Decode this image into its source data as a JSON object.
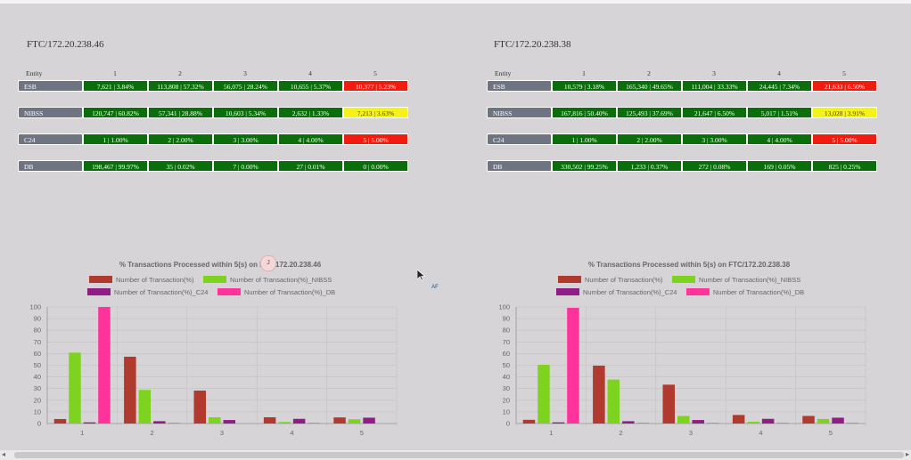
{
  "panels": [
    {
      "title": "FTC/172.20.238.46",
      "entity_header": "Entity",
      "columns": [
        "1",
        "2",
        "3",
        "4",
        "5"
      ],
      "rows": [
        {
          "entity": "ESB",
          "cells": [
            {
              "text": "7,621 | 3.84%",
              "status": "green"
            },
            {
              "text": "113,808 | 57.32%",
              "status": "green"
            },
            {
              "text": "56,075 | 28.24%",
              "status": "green"
            },
            {
              "text": "10,655 | 5.37%",
              "status": "green"
            },
            {
              "text": "10,377 | 5.23%",
              "status": "red"
            }
          ]
        },
        {
          "entity": "NIBSS",
          "cells": [
            {
              "text": "120,747 | 60.82%",
              "status": "green"
            },
            {
              "text": "57,341 | 28.88%",
              "status": "green"
            },
            {
              "text": "10,603 | 5.34%",
              "status": "green"
            },
            {
              "text": "2,632 | 1.33%",
              "status": "green"
            },
            {
              "text": "7,213 | 3.63%",
              "status": "yellow"
            }
          ]
        },
        {
          "entity": "C24",
          "cells": [
            {
              "text": "1 | 1.00%",
              "status": "green"
            },
            {
              "text": "2 | 2.00%",
              "status": "green"
            },
            {
              "text": "3 | 3.00%",
              "status": "green"
            },
            {
              "text": "4 | 4.00%",
              "status": "green"
            },
            {
              "text": "5 | 5.00%",
              "status": "red"
            }
          ]
        },
        {
          "entity": "DB",
          "cells": [
            {
              "text": "198,467 | 99.97%",
              "status": "green"
            },
            {
              "text": "35 | 0.02%",
              "status": "green"
            },
            {
              "text": "7 | 0.00%",
              "status": "green"
            },
            {
              "text": "27 | 0.01%",
              "status": "green"
            },
            {
              "text": "0 | 0.00%",
              "status": "green"
            }
          ]
        }
      ]
    },
    {
      "title": "FTC/172.20.238.38",
      "entity_header": "Entity",
      "columns": [
        "1",
        "2",
        "3",
        "4",
        "5"
      ],
      "rows": [
        {
          "entity": "ESB",
          "cells": [
            {
              "text": "10,579 | 3.18%",
              "status": "green"
            },
            {
              "text": "165,340 | 49.65%",
              "status": "green"
            },
            {
              "text": "111,004 | 33.33%",
              "status": "green"
            },
            {
              "text": "24,445 | 7.34%",
              "status": "green"
            },
            {
              "text": "21,633 | 6.50%",
              "status": "red"
            }
          ]
        },
        {
          "entity": "NIBSS",
          "cells": [
            {
              "text": "167,816 | 50.40%",
              "status": "green"
            },
            {
              "text": "125,493 | 37.69%",
              "status": "green"
            },
            {
              "text": "21,647 | 6.50%",
              "status": "green"
            },
            {
              "text": "5,017 | 1.51%",
              "status": "green"
            },
            {
              "text": "13,028 | 3.91%",
              "status": "yellow"
            }
          ]
        },
        {
          "entity": "C24",
          "cells": [
            {
              "text": "1 | 1.00%",
              "status": "green"
            },
            {
              "text": "2 | 2.00%",
              "status": "green"
            },
            {
              "text": "3 | 3.00%",
              "status": "green"
            },
            {
              "text": "4 | 4.00%",
              "status": "green"
            },
            {
              "text": "5 | 5.00%",
              "status": "red"
            }
          ]
        },
        {
          "entity": "DB",
          "cells": [
            {
              "text": "330,502 | 99.25%",
              "status": "green"
            },
            {
              "text": "1,233 | 0.37%",
              "status": "green"
            },
            {
              "text": "272 | 0.08%",
              "status": "green"
            },
            {
              "text": "169 | 0.05%",
              "status": "green"
            },
            {
              "text": "825 | 0.25%",
              "status": "green"
            }
          ]
        }
      ]
    }
  ],
  "chart_data": [
    {
      "type": "bar",
      "title": "% Transactions Processed within 5(s) on FTC/172.20.238.46",
      "categories": [
        "1",
        "2",
        "3",
        "4",
        "5"
      ],
      "ylim": [
        0,
        100
      ],
      "yticks": [
        0,
        10,
        20,
        30,
        40,
        50,
        60,
        70,
        80,
        90,
        100
      ],
      "grid": true,
      "legend_position": "top",
      "series": [
        {
          "name": "Number of Transaction(%)",
          "color": "#b03a2e",
          "values": [
            3.84,
            57.32,
            28.24,
            5.37,
            5.23
          ]
        },
        {
          "name": "Number of Transaction(%)_NIBSS",
          "color": "#7ed321",
          "values": [
            60.82,
            28.88,
            5.34,
            1.33,
            3.63
          ]
        },
        {
          "name": "Number of Transaction(%)_C24",
          "color": "#8e1e86",
          "values": [
            1,
            2,
            3,
            4,
            5
          ]
        },
        {
          "name": "Number of Transaction(%)_DB",
          "color": "#ff3399",
          "values": [
            99.97,
            0.02,
            0.0,
            0.01,
            0.0
          ]
        }
      ]
    },
    {
      "type": "bar",
      "title": "% Transactions Processed within 5(s) on FTC/172.20.238.38",
      "categories": [
        "1",
        "2",
        "3",
        "4",
        "5"
      ],
      "ylim": [
        0,
        100
      ],
      "yticks": [
        0,
        10,
        20,
        30,
        40,
        50,
        60,
        70,
        80,
        90,
        100
      ],
      "grid": true,
      "legend_position": "top",
      "series": [
        {
          "name": "Number of Transaction(%)",
          "color": "#b03a2e",
          "values": [
            3.18,
            49.65,
            33.33,
            7.34,
            6.5
          ]
        },
        {
          "name": "Number of Transaction(%)_NIBSS",
          "color": "#7ed321",
          "values": [
            50.4,
            37.69,
            6.5,
            1.51,
            3.91
          ]
        },
        {
          "name": "Number of Transaction(%)_C24",
          "color": "#8e1e86",
          "values": [
            1,
            2,
            3,
            4,
            5
          ]
        },
        {
          "name": "Number of Transaction(%)_DB",
          "color": "#ff3399",
          "values": [
            99.25,
            0.37,
            0.08,
            0.05,
            0.25
          ]
        }
      ]
    }
  ],
  "overlay": {
    "cursor_icon": "mouse-pointer-icon",
    "af_label": "AF",
    "pin_label": "J"
  },
  "colors": {
    "green": "#0a6e0a",
    "red": "#f21b0f",
    "yellow": "#f5f21a",
    "entity": "#6e7482"
  }
}
